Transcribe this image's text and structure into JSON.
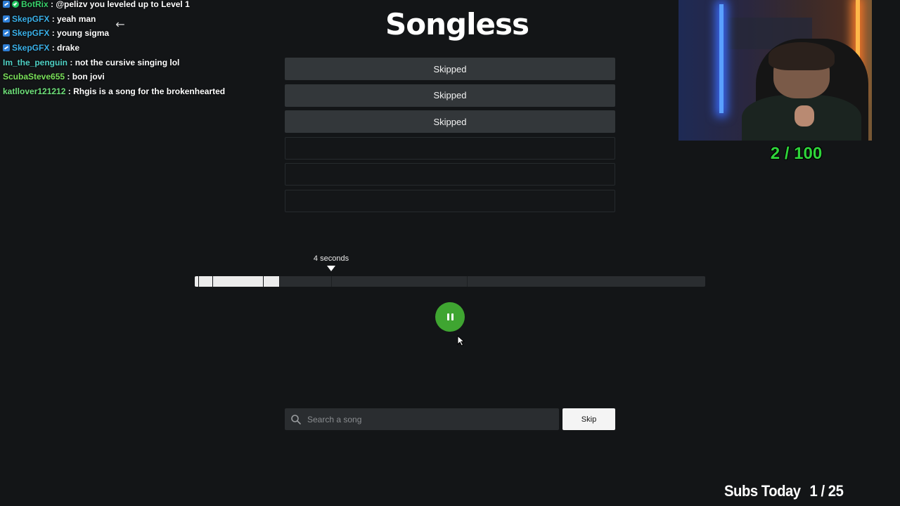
{
  "chat": [
    {
      "user": "BotRix",
      "color": "#38d26b",
      "badges": [
        "mod",
        "verified"
      ],
      "message": "@pelizv you leveled up to Level 1"
    },
    {
      "user": "SkepGFX",
      "color": "#3ab0e8",
      "badges": [
        "mod"
      ],
      "message": "yeah man"
    },
    {
      "user": "SkepGFX",
      "color": "#3ab0e8",
      "badges": [
        "mod"
      ],
      "message": "young sigma"
    },
    {
      "user": "SkepGFX",
      "color": "#3ab0e8",
      "badges": [
        "mod"
      ],
      "message": "drake"
    },
    {
      "user": "Im_the_penguin",
      "color": "#4fd1c5",
      "badges": [],
      "message": "not the cursive singing lol"
    },
    {
      "user": "ScubaSteve655",
      "color": "#7ae05a",
      "badges": [],
      "message": "bon jovi"
    },
    {
      "user": "katllover121212",
      "color": "#6ee07a",
      "badges": [],
      "message": "Rhgis is a song for the brokenhearted"
    }
  ],
  "game": {
    "title": "Songless",
    "guesses": [
      "Skipped",
      "Skipped",
      "Skipped",
      "",
      "",
      ""
    ],
    "timeline_label": "4 seconds",
    "played_fraction": 0.165,
    "segment_fractions": [
      0.0069,
      0.0344,
      0.1341,
      0.1652,
      0.2672,
      0.5331
    ],
    "search_placeholder": "Search a song",
    "skip_label": "Skip"
  },
  "overlay": {
    "counter": "2 / 100",
    "subs_label": "Subs Today",
    "subs_value": "1 / 25"
  },
  "colors": {
    "accent_green": "#3fa531",
    "counter_green": "#2fd43a"
  }
}
